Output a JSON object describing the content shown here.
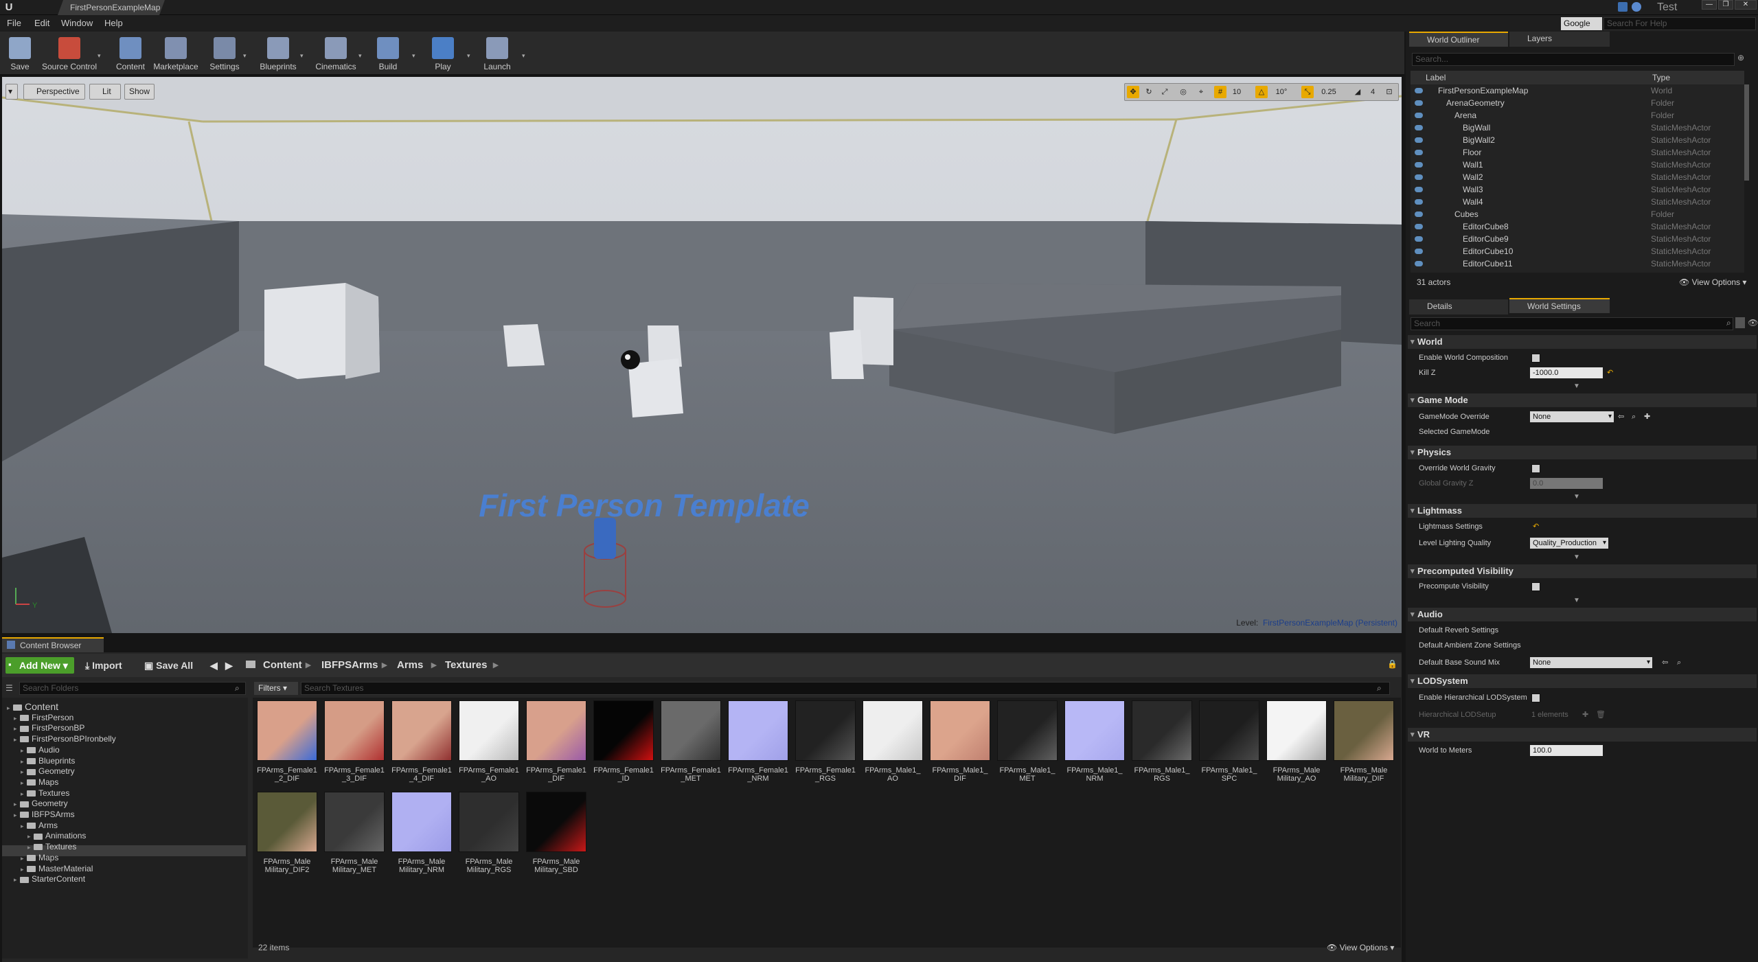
{
  "window": {
    "tab_title": "FirstPersonExampleMap",
    "project_name": "Test",
    "buttons": [
      "—",
      "❐",
      "✕"
    ]
  },
  "menu": [
    "File",
    "Edit",
    "Window",
    "Help"
  ],
  "help_search": {
    "engine": "Google",
    "placeholder": "Search For Help"
  },
  "toolbar": [
    {
      "label": "Save",
      "icon": "save-icon",
      "color": "#8fa6c8"
    },
    {
      "label": "Source Control",
      "icon": "source-control-icon",
      "color": "#c84c3c"
    },
    {
      "label": "Content",
      "icon": "content-icon",
      "color": "#6f8fc0"
    },
    {
      "label": "Marketplace",
      "icon": "marketplace-icon",
      "color": "#8090b0"
    },
    {
      "label": "Settings",
      "icon": "settings-icon",
      "color": "#7a8aa8"
    },
    {
      "label": "Blueprints",
      "icon": "blueprints-icon",
      "color": "#8a9ab8"
    },
    {
      "label": "Cinematics",
      "icon": "cinematics-icon",
      "color": "#8a9ab8"
    },
    {
      "label": "Build",
      "icon": "build-icon",
      "color": "#6f8fc0"
    },
    {
      "label": "Play",
      "icon": "play-icon",
      "color": "#4b7fc6"
    },
    {
      "label": "Launch",
      "icon": "launch-icon",
      "color": "#8a9ab8"
    }
  ],
  "viewport": {
    "buttons": [
      "▾",
      "Perspective",
      "Lit",
      "Show"
    ],
    "grid_snap": "10",
    "rotation_snap": "10°",
    "scale_snap": "0.25",
    "camera_speed": "4",
    "level_label": "Level:",
    "level_name": "FirstPersonExampleMap (Persistent)",
    "floor_text": "First Person Template"
  },
  "content_browser": {
    "tab": "Content Browser",
    "add_new": "Add New",
    "import": "Import",
    "save_all": "Save All",
    "breadcrumb": [
      "Content",
      "IBFPSArms",
      "Arms",
      "Textures"
    ],
    "folder_search_placeholder": "Search Folders",
    "filters_label": "Filters",
    "asset_search_placeholder": "Search Textures",
    "item_count": "22 items",
    "view_options": "View Options",
    "tree": [
      {
        "label": "Content",
        "level": 0
      },
      {
        "label": "FirstPerson",
        "level": 1
      },
      {
        "label": "FirstPersonBP",
        "level": 1
      },
      {
        "label": "FirstPersonBPIronbelly",
        "level": 1
      },
      {
        "label": "Audio",
        "level": 2
      },
      {
        "label": "Blueprints",
        "level": 2
      },
      {
        "label": "Geometry",
        "level": 2
      },
      {
        "label": "Maps",
        "level": 2
      },
      {
        "label": "Textures",
        "level": 2
      },
      {
        "label": "Geometry",
        "level": 1
      },
      {
        "label": "IBFPSArms",
        "level": 1
      },
      {
        "label": "Arms",
        "level": 2
      },
      {
        "label": "Animations",
        "level": 3
      },
      {
        "label": "Textures",
        "level": 3
      },
      {
        "label": "Maps",
        "level": 2
      },
      {
        "label": "MasterMaterial",
        "level": 2
      },
      {
        "label": "StarterContent",
        "level": 1
      }
    ],
    "assets": [
      {
        "name": "FPArms_Female1\n_2_DIF",
        "color": "#d9a08a",
        "accent": "#3a6ad8"
      },
      {
        "name": "FPArms_Female1\n_3_DIF",
        "color": "#d59c86",
        "accent": "#b03030"
      },
      {
        "name": "FPArms_Female1\n_4_DIF",
        "color": "#d8a48e",
        "accent": "#903030"
      },
      {
        "name": "FPArms_Female1\n_AO",
        "color": "#f0f0f0",
        "accent": "#bbbbbb"
      },
      {
        "name": "FPArms_Female1\n_DIF",
        "color": "#d8a08c",
        "accent": "#9a5aa8"
      },
      {
        "name": "FPArms_Female1\n_ID",
        "color": "#050505",
        "accent": "#d01010"
      },
      {
        "name": "FPArms_Female1\n_MET",
        "color": "#6a6a6a",
        "accent": "#333333"
      },
      {
        "name": "FPArms_Female1\n_NRM",
        "color": "#b4b4f4",
        "accent": "#a0a0e8"
      },
      {
        "name": "FPArms_Female1\n_RGS",
        "color": "#222222",
        "accent": "#555555"
      },
      {
        "name": "FPArms_Male1_\nAO",
        "color": "#eeeeee",
        "accent": "#c8c8c8"
      },
      {
        "name": "FPArms_Male1_\nDIF",
        "color": "#dca48c",
        "accent": "#c08070"
      },
      {
        "name": "FPArms_Male1_\nMET",
        "color": "#222222",
        "accent": "#606060"
      },
      {
        "name": "FPArms_Male1_\nNRM",
        "color": "#b8b8f6",
        "accent": "#a8a8ee"
      },
      {
        "name": "FPArms_Male1_\nRGS",
        "color": "#2a2a2a",
        "accent": "#6a6a6a"
      },
      {
        "name": "FPArms_Male1_\nSPC",
        "color": "#1e1e1e",
        "accent": "#4a4a4a"
      },
      {
        "name": "FPArms_Male\nMilitary_AO",
        "color": "#f4f4f4",
        "accent": "#aaaaaa"
      },
      {
        "name": "FPArms_Male\nMilitary_DIF",
        "color": "#6a6040",
        "accent": "#d8a890"
      },
      {
        "name": "FPArms_Male\nMilitary_DIF2",
        "color": "#5a5a38",
        "accent": "#d8a890"
      },
      {
        "name": "FPArms_Male\nMilitary_MET",
        "color": "#3a3a3a",
        "accent": "#666666"
      },
      {
        "name": "FPArms_Male\nMilitary_NRM",
        "color": "#b0b0f2",
        "accent": "#9c9ce8"
      },
      {
        "name": "FPArms_Male\nMilitary_RGS",
        "color": "#2e2e2e",
        "accent": "#444444"
      },
      {
        "name": "FPArms_Male\nMilitary_SBD",
        "color": "#0a0a0a",
        "accent": "#c81818"
      }
    ]
  },
  "outliner": {
    "tabs": [
      "World Outliner",
      "Layers"
    ],
    "search_placeholder": "Search...",
    "col_label": "Label",
    "col_type": "Type",
    "rows": [
      {
        "label": "FirstPersonExampleMap",
        "type": "World",
        "level": 0
      },
      {
        "label": "ArenaGeometry",
        "type": "Folder",
        "level": 1
      },
      {
        "label": "Arena",
        "type": "Folder",
        "level": 2
      },
      {
        "label": "BigWall",
        "type": "StaticMeshActor",
        "level": 3
      },
      {
        "label": "BigWall2",
        "type": "StaticMeshActor",
        "level": 3
      },
      {
        "label": "Floor",
        "type": "StaticMeshActor",
        "level": 3
      },
      {
        "label": "Wall1",
        "type": "StaticMeshActor",
        "level": 3
      },
      {
        "label": "Wall2",
        "type": "StaticMeshActor",
        "level": 3
      },
      {
        "label": "Wall3",
        "type": "StaticMeshActor",
        "level": 3
      },
      {
        "label": "Wall4",
        "type": "StaticMeshActor",
        "level": 3
      },
      {
        "label": "Cubes",
        "type": "Folder",
        "level": 2
      },
      {
        "label": "EditorCube8",
        "type": "StaticMeshActor",
        "level": 3
      },
      {
        "label": "EditorCube9",
        "type": "StaticMeshActor",
        "level": 3
      },
      {
        "label": "EditorCube10",
        "type": "StaticMeshActor",
        "level": 3
      },
      {
        "label": "EditorCube11",
        "type": "StaticMeshActor",
        "level": 3
      }
    ],
    "actor_count": "31 actors",
    "view_options": "View Options"
  },
  "details": {
    "tabs": [
      "Details",
      "World Settings"
    ],
    "search_placeholder": "Search",
    "sections": {
      "world": "World",
      "game_mode": "Game Mode",
      "physics": "Physics",
      "lightmass": "Lightmass",
      "precomputed": "Precomputed Visibility",
      "audio": "Audio",
      "lod": "LODSystem",
      "vr": "VR"
    },
    "props": {
      "enable_world_composition": "Enable World Composition",
      "kill_z": "Kill Z",
      "kill_z_value": "-1000.0",
      "gamemode_override": "GameMode Override",
      "gamemode_value": "None",
      "selected_gamemode": "Selected GameMode",
      "override_gravity": "Override World Gravity",
      "global_gravity": "Global Gravity Z",
      "global_gravity_value": "0.0",
      "lightmass_settings": "Lightmass Settings",
      "lighting_quality": "Level Lighting Quality",
      "lighting_quality_value": "Quality_Production",
      "precompute_visibility": "Precompute Visibility",
      "default_reverb": "Default Reverb Settings",
      "default_ambient_zone": "Default Ambient Zone Settings",
      "default_base_sound_mix": "Default Base Sound Mix",
      "sound_mix_value": "None",
      "enable_hlod": "Enable Hierarchical LODSystem",
      "hlod_setup": "Hierarchical LODSetup",
      "hlod_elements": "1 elements",
      "world_to_meters": "World to Meters",
      "world_to_meters_value": "100.0"
    }
  }
}
